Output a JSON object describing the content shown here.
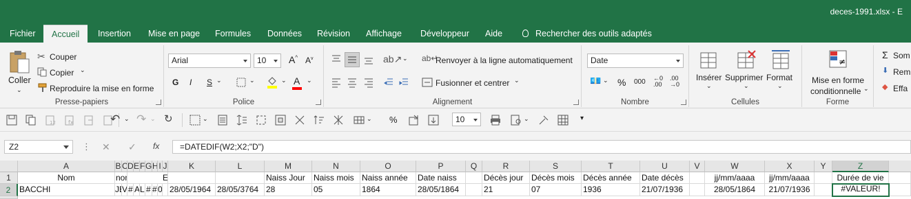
{
  "window": {
    "title": "deces-1991.xlsx - E"
  },
  "tabs": [
    "Fichier",
    "Accueil",
    "Insertion",
    "Mise en page",
    "Formules",
    "Données",
    "Révision",
    "Affichage",
    "Développeur",
    "Aide"
  ],
  "tell_me": "Rechercher des outils adaptés",
  "ribbon": {
    "clipboard": {
      "paste": "Coller",
      "cut": "Couper",
      "copy": "Copier",
      "format_painter": "Reproduire la mise en forme",
      "label": "Presse-papiers"
    },
    "font": {
      "name": "Arial",
      "size": "10",
      "bold": "G",
      "italic": "I",
      "underline": "S",
      "label": "Police",
      "fill_color": "#ffff00",
      "font_color": "#ff0000"
    },
    "alignment": {
      "wrap": "Renvoyer à la ligne automatiquement",
      "merge": "Fusionner et centrer",
      "label": "Alignement"
    },
    "number": {
      "format": "Date",
      "percent": "%",
      "thousands": "000",
      "label": "Nombre"
    },
    "cells": {
      "insert": "Insérer",
      "delete": "Supprimer",
      "format": "Format",
      "label": "Cellules"
    },
    "styles": {
      "conditional_1": "Mise en forme",
      "conditional_2": "conditionnelle",
      "label": "Forme"
    },
    "editing": {
      "sum": "Som",
      "fill": "Rem",
      "clear": "Effa"
    }
  },
  "qat": {
    "font_size": "10"
  },
  "formula_bar": {
    "name_box": "Z2",
    "formula": "=DATEDIF(W2;X2;\"D\")",
    "fx": "fx"
  },
  "grid": {
    "columns": [
      "A",
      "B",
      "C",
      "D",
      "E",
      "F",
      "G",
      "H",
      "I",
      "J",
      "K",
      "L",
      "M",
      "N",
      "O",
      "P",
      "Q",
      "R",
      "S",
      "T",
      "U",
      "V",
      "W",
      "X",
      "Y",
      "Z"
    ],
    "rows": [
      "1",
      "2"
    ],
    "row1": {
      "A": "Nom",
      "B": "nom",
      "C": "",
      "D": "",
      "E": "",
      "F": "",
      "G": "",
      "H": "",
      "I": "",
      "J": "EC",
      "K": "",
      "L": "",
      "M": "Naiss Jour",
      "N": "Naiss mois",
      "O": "Naiss année",
      "P": "Date naiss",
      "Q": "",
      "R": "Décès jour",
      "S": "Décès mois",
      "T": "Décès année",
      "U": "Date décès",
      "V": "",
      "W": "jj/mm/aaaa",
      "X": "jj/mm/aaaa",
      "Y": "",
      "Z": "Durée de vie"
    },
    "row2": {
      "A": "BACCHI",
      "B": "JE",
      "C": "V",
      "D": "#",
      "E": "A",
      "F": "L",
      "G": "#",
      "H": "#",
      "I": "0",
      "J": "",
      "K": "28/05/1964",
      "L": "28/05/3764",
      "M": "28",
      "N": "05",
      "O": "1864",
      "P": "28/05/1864",
      "Q": "",
      "R": "21",
      "S": "07",
      "T": "1936",
      "U": "21/07/1936",
      "V": "",
      "W": "28/05/1864",
      "X": "21/07/1936",
      "Y": "",
      "Z": "#VALEUR!"
    }
  }
}
